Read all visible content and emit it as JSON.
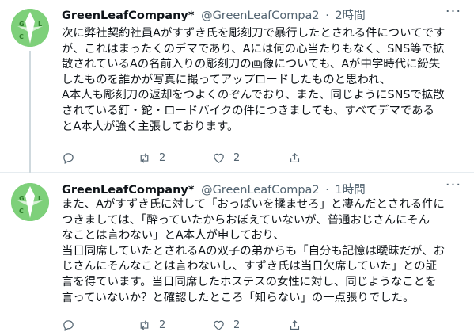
{
  "tweets": [
    {
      "display_name": "GreenLeafCompany*",
      "handle": "@GreenLeafCompa2",
      "dot": "·",
      "time": "2時間",
      "lines": [
        "次に弊社契約社員Aがすずき氏を彫刻刀で暴行したとされる件についてです",
        "が、これはまったくのデマであり、Aには何の心当たりもなく、SNS等で拡",
        "散されているAの名前入りの彫刻刀の画像についても、Aが中学時代に紛失",
        "したものを誰かが写真に撮ってアップロードしたものと思われ、",
        "A本人も彫刻刀の返却をつよくのぞんでおり、また、同じようにSNSで拡散",
        "されている釘・鉈・ロードバイクの件につきましても、すべてデマである",
        "とA本人が強く主張しております。"
      ],
      "retweet_count": "2",
      "like_count": "2",
      "avatar_letters": [
        "G",
        "L",
        "C"
      ]
    },
    {
      "display_name": "GreenLeafCompany*",
      "handle": "@GreenLeafCompa2",
      "dot": "·",
      "time": "1時間",
      "lines": [
        "また、Aがすずき氏に対して「おっぱいを揉ませろ」と凄んだとされる件に",
        "つきましては、「酔っていたからおぼえていないが、普通おじさんにそん",
        "なことは言わない」とA本人が申しており、",
        "当日同席していたとされるAの双子の弟からも「自分も記憶は曖昧だが、お",
        "じさんにそんなことは言わないし、すずき氏は当日欠席していた」との証",
        "言を得ています。当日同席したホステスの女性に対し、同じようなことを",
        "言っていないか？と確認したところ「知らない」の一点張りでした。"
      ],
      "retweet_count": "2",
      "like_count": "2",
      "avatar_letters": [
        "G",
        "L",
        "C"
      ]
    }
  ],
  "icons": {
    "reply": "reply-icon",
    "retweet": "retweet-icon",
    "like": "heart-icon",
    "share": "share-icon",
    "more": "more-icon"
  },
  "colors": {
    "avatar_green": "#7ed07a",
    "text_secondary": "#536471",
    "divider": "#e6ecf0"
  }
}
